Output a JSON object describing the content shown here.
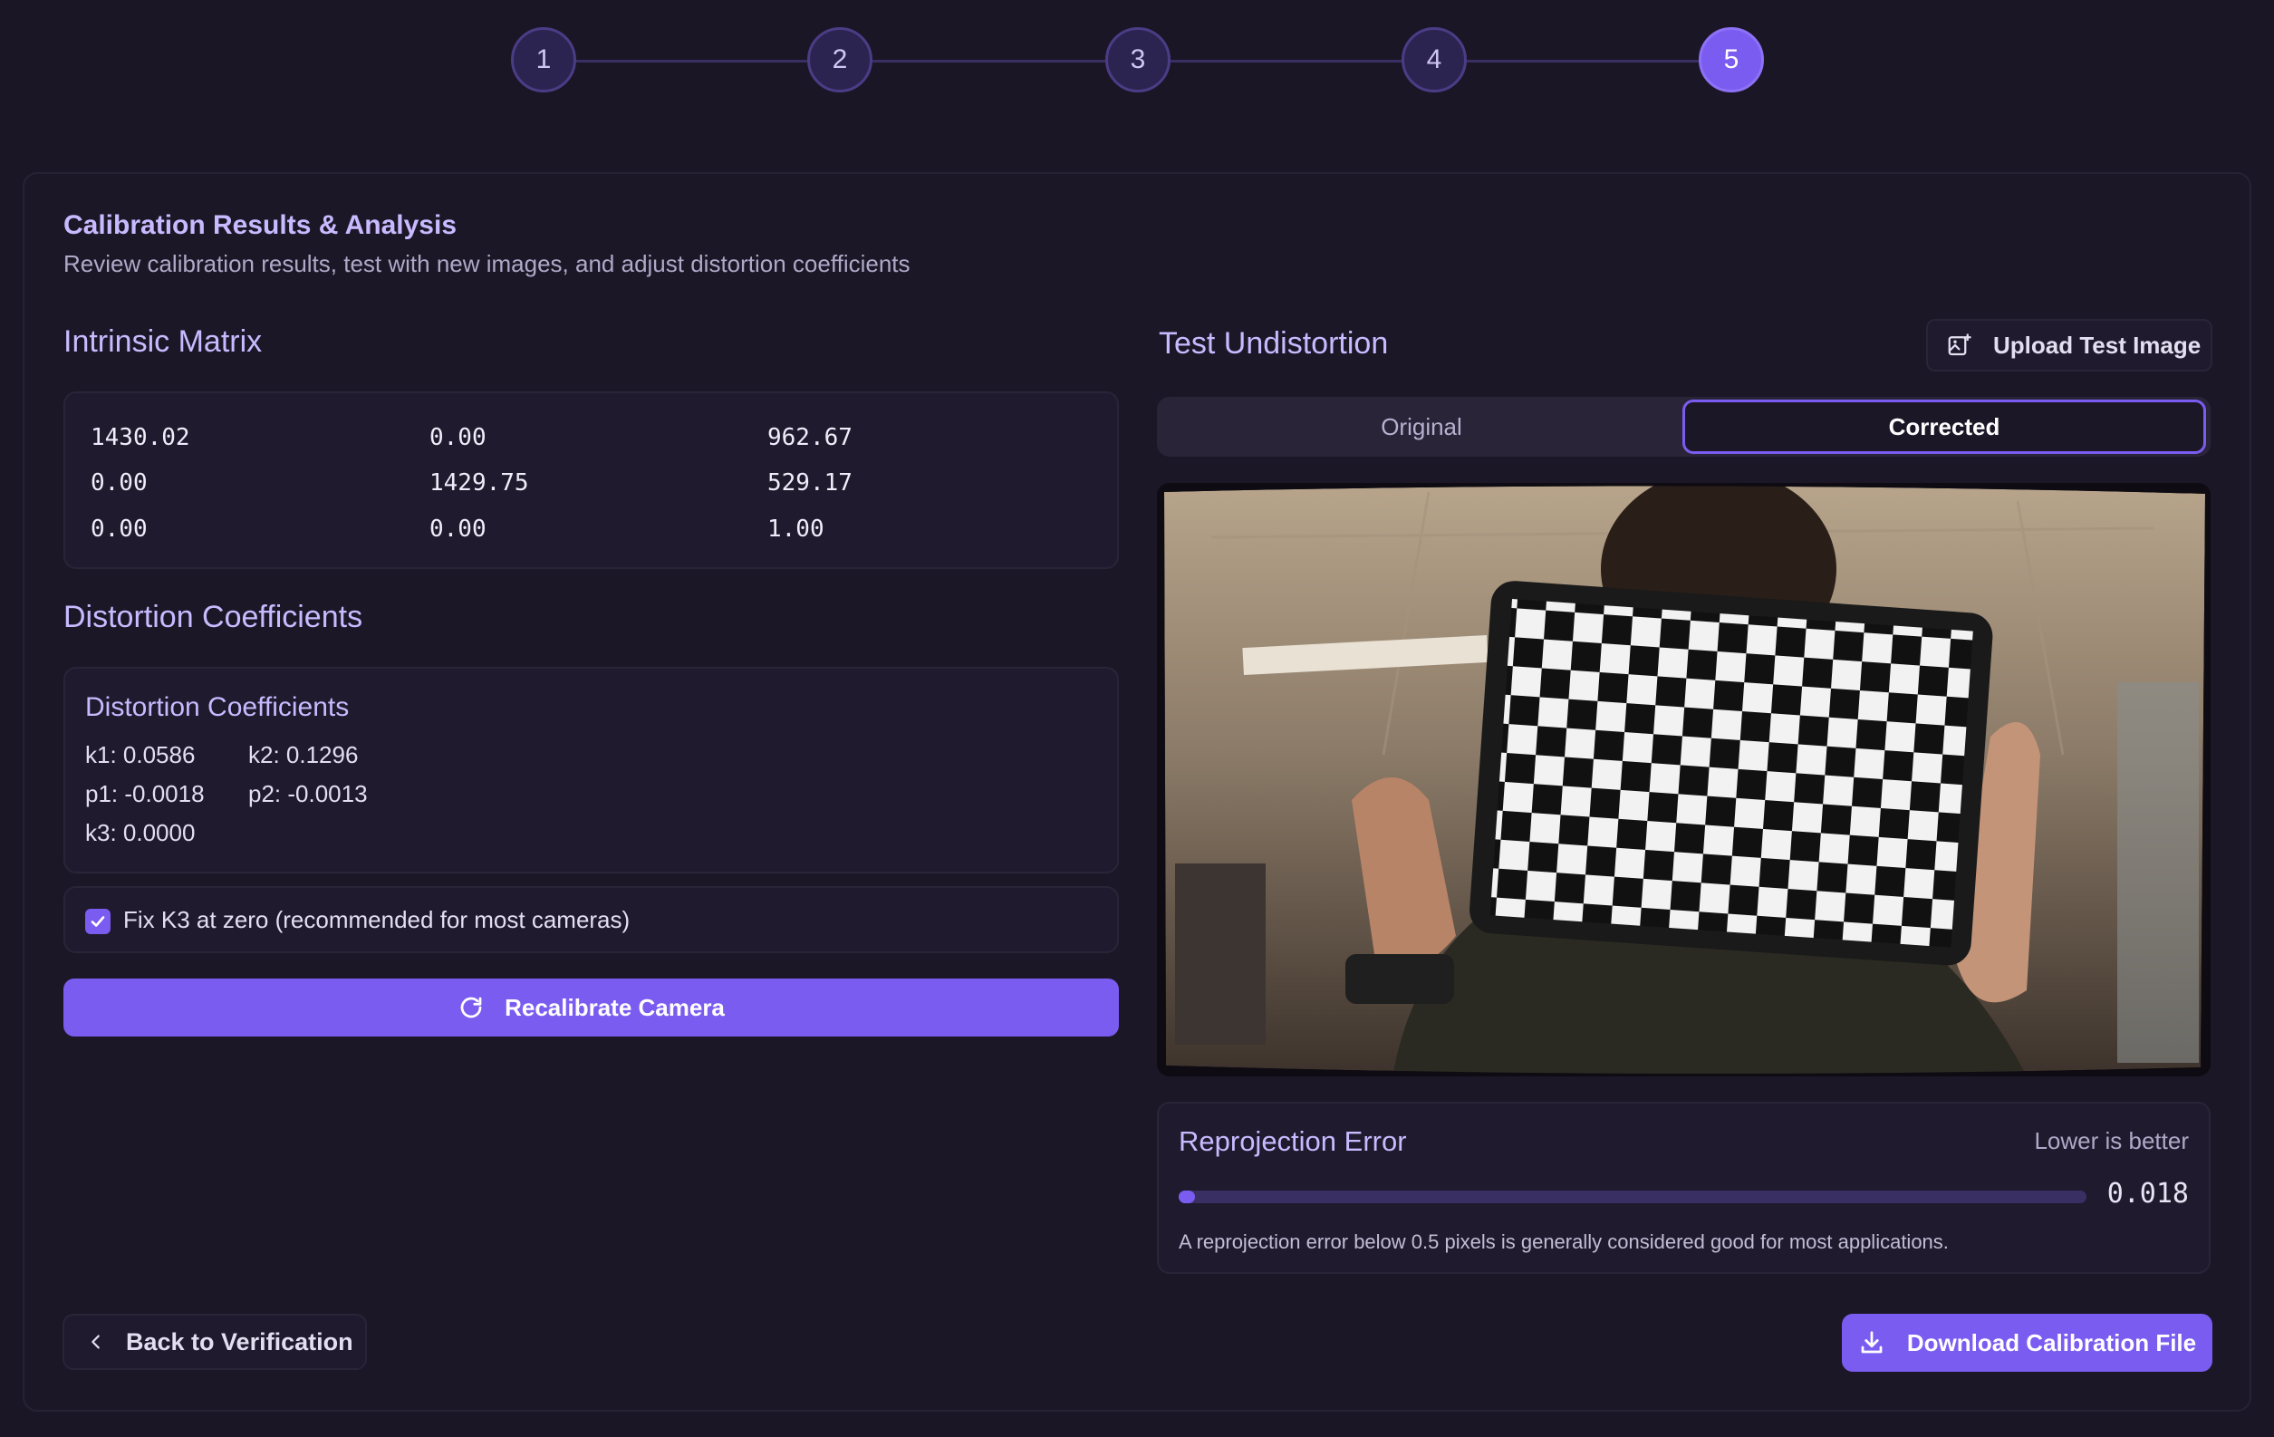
{
  "stepper": {
    "steps": [
      "1",
      "2",
      "3",
      "4",
      "5"
    ],
    "active_step": 5
  },
  "header": {
    "title": "Calibration Results & Analysis",
    "subtitle": "Review calibration results, test with new images, and adjust distortion coefficients"
  },
  "intrinsic": {
    "heading": "Intrinsic Matrix",
    "rows": [
      [
        "1430.02",
        "0.00",
        "962.67"
      ],
      [
        "0.00",
        "1429.75",
        "529.17"
      ],
      [
        "0.00",
        "0.00",
        "1.00"
      ]
    ]
  },
  "distortion": {
    "heading": "Distortion Coefficients",
    "panel_title": "Distortion Coefficients",
    "k1": "k1: 0.0586",
    "k2": "k2: 0.1296",
    "p1": "p1: -0.0018",
    "p2": "p2: -0.0013",
    "k3": "k3: 0.0000"
  },
  "fix_k3": {
    "label": "Fix K3 at zero (recommended for most cameras)",
    "checked": true
  },
  "recalibrate": {
    "label": "Recalibrate Camera"
  },
  "test": {
    "heading": "Test Undistortion",
    "upload_label": "Upload Test Image",
    "toggle": {
      "original": "Original",
      "corrected": "Corrected",
      "selected": "Corrected"
    }
  },
  "reprojection": {
    "title": "Reprojection Error",
    "hint": "Lower is better",
    "value": "0.018",
    "fill_fraction": 0.018,
    "note": "A reprojection error below 0.5 pixels is generally considered good for most applications."
  },
  "footer": {
    "back_label": "Back to Verification",
    "download_label": "Download Calibration File"
  },
  "colors": {
    "accent": "#7b5cf0",
    "background": "#1b1626",
    "heading": "#c9baff"
  }
}
